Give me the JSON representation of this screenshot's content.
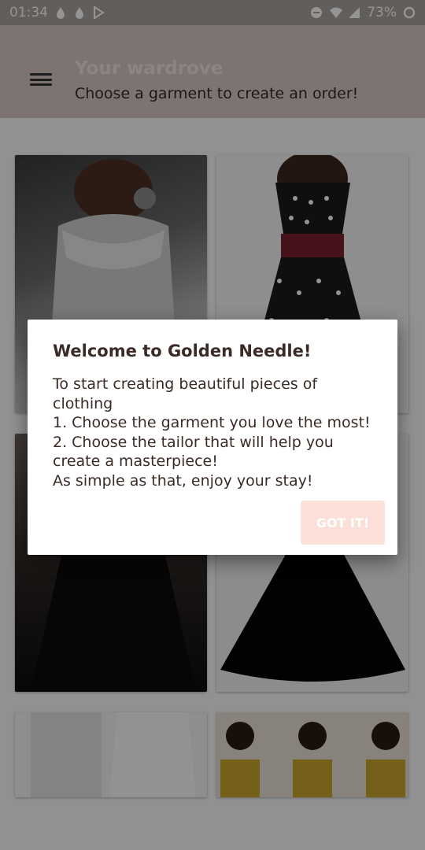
{
  "status_bar": {
    "time": "01:34",
    "battery": "73%",
    "left_icons": [
      "drop-icon",
      "drop-icon",
      "play-store-icon"
    ],
    "right_icons": [
      "do-not-disturb-icon",
      "wifi-icon",
      "signal-icon",
      "battery-icon"
    ]
  },
  "header": {
    "title": "Your wardrove",
    "subtitle": "Choose a garment to create an order!",
    "menu_icon": "menu-icon"
  },
  "garments": [
    {
      "name": "grey-lace-dress"
    },
    {
      "name": "polka-dot-dress"
    },
    {
      "name": "black-long-dress"
    },
    {
      "name": "black-flared-dress"
    },
    {
      "name": "white-lace-dress"
    },
    {
      "name": "yellow-patterned-dress"
    }
  ],
  "dialog": {
    "title": "Welcome to Golden Needle!",
    "lines": [
      "To start creating beautiful pieces of",
      "clothing",
      "1. Choose the garment you love the most!",
      "2. Choose the tailor that will help you",
      "create a masterpiece!",
      "As simple as that, enjoy your stay!"
    ],
    "button_label": "GOT IT!"
  },
  "colors": {
    "accent": "#fbe0da",
    "header_bg": "#d7c9c3",
    "text_dark": "#3b2a25"
  }
}
